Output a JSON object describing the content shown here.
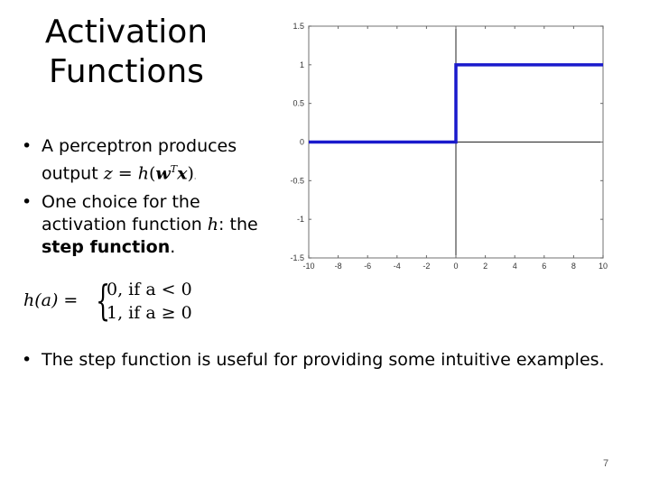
{
  "slide": {
    "title_line1": "Activation",
    "title_line2": "Functions",
    "bullet1": {
      "marker": "•",
      "text_before": "A perceptron produces output ",
      "math_z": "z",
      "math_eq": " = ",
      "math_h": "h",
      "math_open": "(",
      "math_w": "w",
      "math_T": "T",
      "math_x": "x",
      "math_close": ")",
      "text_after": "."
    },
    "bullet2": {
      "marker": "•",
      "text_before": "One choice for the activation function ",
      "math_h": "h",
      "text_colon": ": the ",
      "bold": "step function",
      "text_after": "."
    },
    "formula": {
      "lhs": "h(a) =",
      "brace": "{",
      "case1": "0, if a < 0",
      "case2": "1, if a ≥ 0"
    },
    "bullet3": {
      "marker": "•",
      "text": "The step function is useful for providing some intuitive examples."
    },
    "page_number": "7"
  },
  "chart_data": {
    "type": "line",
    "title": "",
    "xlabel": "",
    "ylabel": "",
    "xlim": [
      -10,
      10
    ],
    "ylim": [
      -1.5,
      1.5
    ],
    "x_ticks": [
      "-10",
      "-8",
      "-6",
      "-4",
      "-2",
      "0",
      "2",
      "4",
      "6",
      "8",
      "10"
    ],
    "y_ticks": [
      "1.5",
      "1",
      "0.5",
      "0",
      "-0.5",
      "-1",
      "-1.5"
    ],
    "grid": false,
    "axes_lines": {
      "x_zero": true,
      "y_zero": true
    },
    "series": [
      {
        "name": "step function",
        "color": "#1a1acc",
        "points": [
          [
            -10,
            0
          ],
          [
            0,
            0
          ],
          [
            0,
            1
          ],
          [
            10,
            1
          ]
        ]
      }
    ]
  }
}
